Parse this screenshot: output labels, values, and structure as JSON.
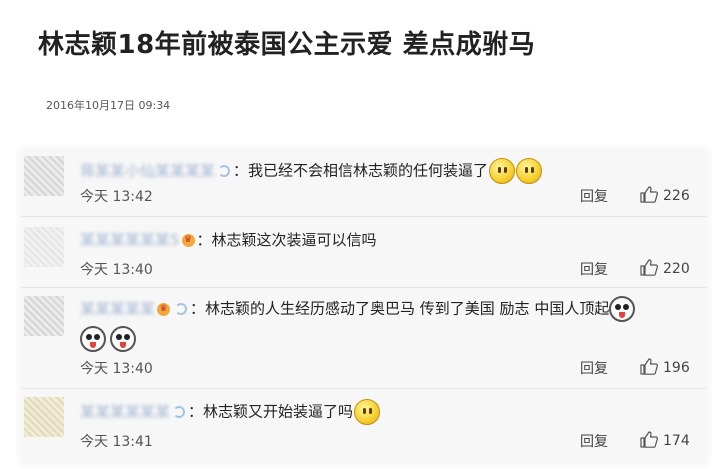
{
  "article": {
    "title": "林志颖18年前被泰国公主示爱 差点成驸马",
    "date": "2016年10月17日 09:34"
  },
  "comments": [
    {
      "user": "蒋某某小仙某某某某",
      "text": "：我已经不会相信林志颖的任何装逼了",
      "emojis": [
        "smile-emoji",
        "smile-emoji"
      ],
      "time": "今天 13:42",
      "reply_label": "回复",
      "likes": "226"
    },
    {
      "user": "某某某某某某5",
      "text": "：林志颖这次装逼可以信吗",
      "emojis": [],
      "time": "今天 13:40",
      "reply_label": "回复",
      "likes": "220"
    },
    {
      "user": "某某某某某",
      "text": "：林志颖的人生经历感动了奥巴马 传到了美国 励志 中国人顶起",
      "emojis": [
        "silly-face-emoji",
        "silly-face-emoji",
        "silly-face-emoji"
      ],
      "time": "今天 13:40",
      "reply_label": "回复",
      "likes": "196"
    },
    {
      "user": "某某某某某某",
      "text": "：林志颖又开始装逼了吗",
      "emojis": [
        "smile-emoji"
      ],
      "time": "今天 13:41",
      "reply_label": "回复",
      "likes": "174"
    }
  ],
  "icons": {
    "like": "thumbs-up-icon",
    "verified": "verified-icon",
    "badge": "member-badge-icon"
  },
  "colors": {
    "username": "#8ea6c9",
    "panel_bg": "#f7f7f7"
  }
}
